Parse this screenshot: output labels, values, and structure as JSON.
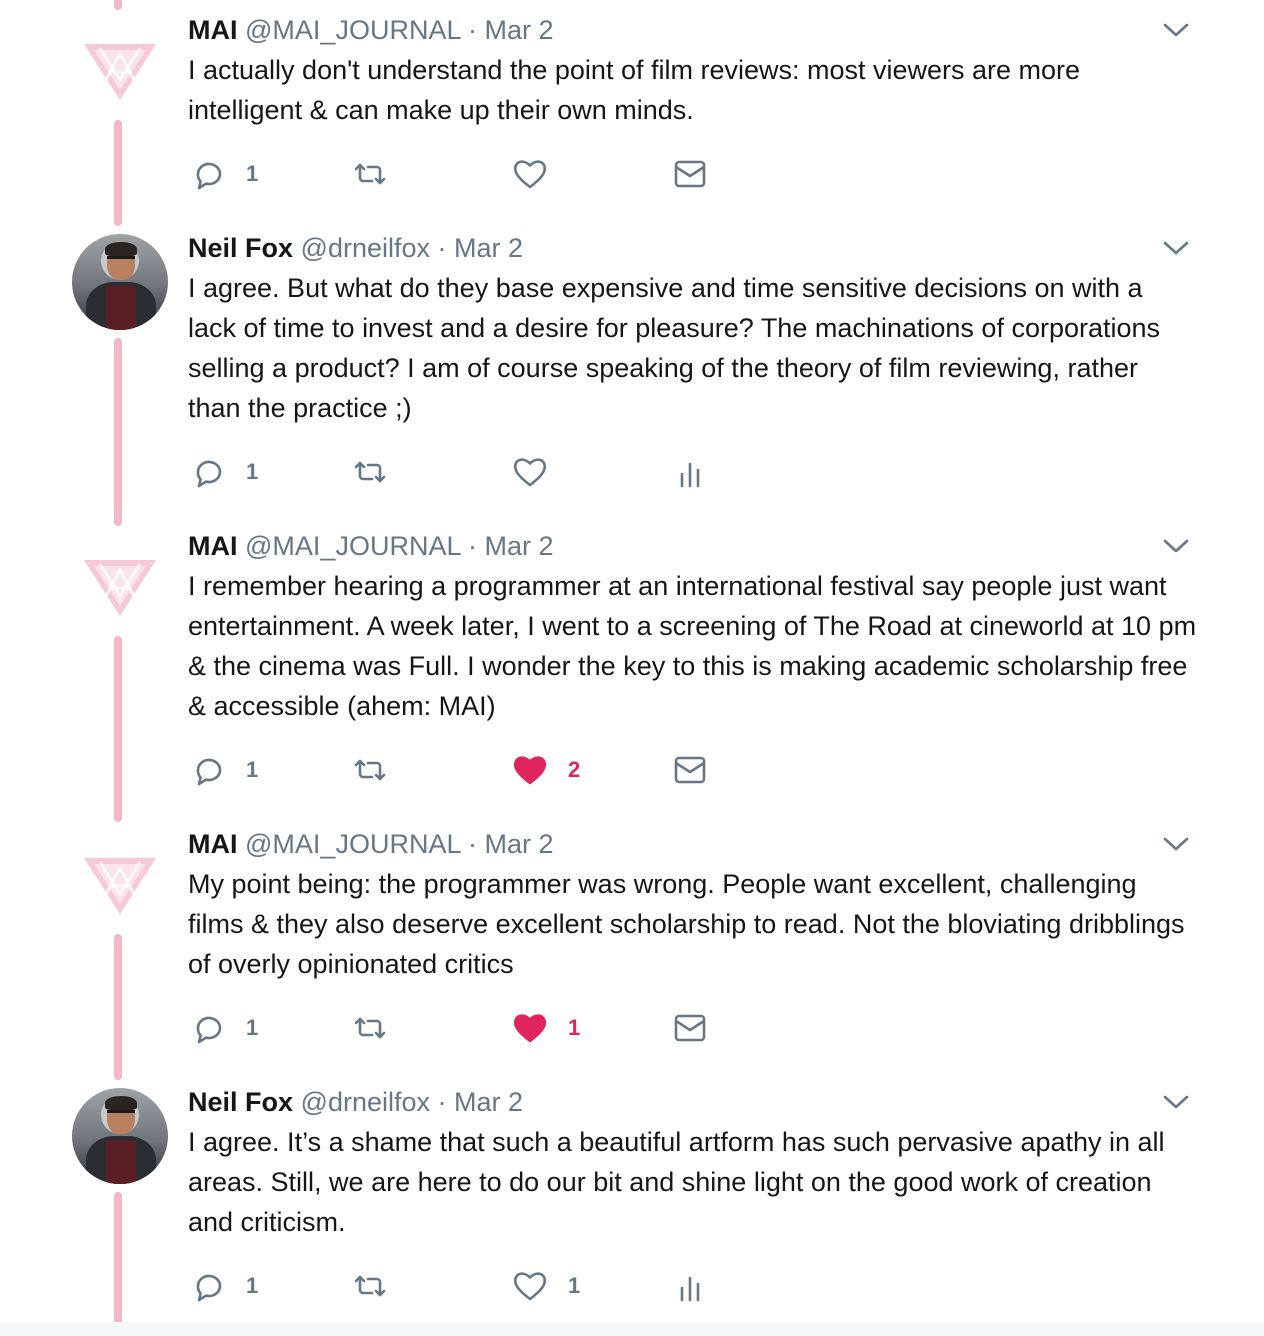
{
  "colors": {
    "thread_line": "#f2b8c6",
    "muted": "#657786",
    "like_active": "#e0245e",
    "text": "#14171a"
  },
  "tweets": [
    {
      "avatar": "mai-logo",
      "name": "MAI",
      "handle": "@MAI_JOURNAL",
      "sep": "·",
      "date": "Mar 2",
      "text": "I actually don't understand the point of film reviews: most viewers are more intelligent & can make up their own minds.",
      "reply_count": "1",
      "like_count": "",
      "liked": false,
      "last_action": "envelope-icon"
    },
    {
      "avatar": "neil-photo",
      "name": "Neil Fox",
      "handle": "@drneilfox",
      "sep": "·",
      "date": "Mar 2",
      "text": "I agree. But what do they base expensive and time sensitive decisions on with a lack of time to invest and a desire for pleasure? The machinations of corporations selling a product? I am of course speaking of the theory of film reviewing, rather than the practice ;)",
      "reply_count": "1",
      "like_count": "",
      "liked": false,
      "last_action": "analytics-icon"
    },
    {
      "avatar": "mai-logo",
      "name": "MAI",
      "handle": "@MAI_JOURNAL",
      "sep": "·",
      "date": "Mar 2",
      "text": "I remember hearing a programmer at an international festival say people just want entertainment. A week later, I went to a screening of The Road at cineworld at 10 pm & the cinema was Full. I wonder the key to this is making academic scholarship free & accessible (ahem: MAI)",
      "reply_count": "1",
      "like_count": "2",
      "liked": true,
      "last_action": "envelope-icon"
    },
    {
      "avatar": "mai-logo",
      "name": "MAI",
      "handle": "@MAI_JOURNAL",
      "sep": "·",
      "date": "Mar 2",
      "text": "My point being: the programmer was wrong. People want excellent, challenging films & they also deserve excellent scholarship to read. Not the bloviating dribblings of overly opinionated critics",
      "reply_count": "1",
      "like_count": "1",
      "liked": true,
      "last_action": "envelope-icon"
    },
    {
      "avatar": "neil-photo",
      "name": "Neil Fox",
      "handle": "@drneilfox",
      "sep": "·",
      "date": "Mar 2",
      "text": "I agree. It’s a shame that such a beautiful artform has such pervasive apathy in all areas. Still, we are here to do our bit and shine light on the good work of creation and criticism.",
      "reply_count": "1",
      "like_count": "1",
      "liked": false,
      "last_action": "analytics-icon"
    }
  ]
}
